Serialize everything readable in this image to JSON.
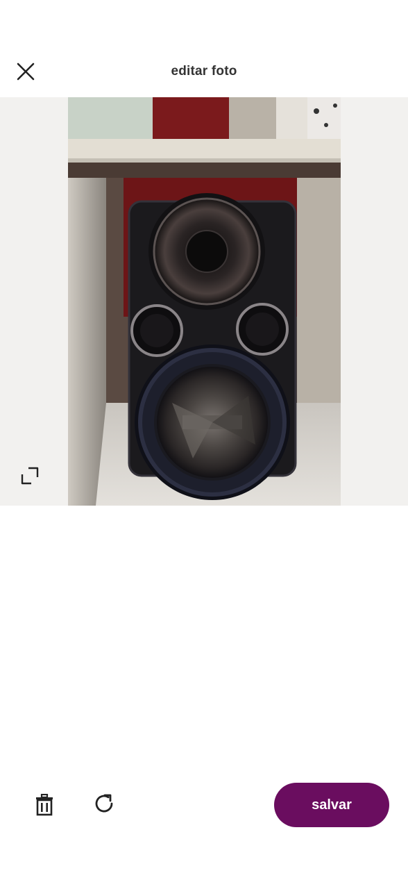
{
  "header": {
    "title": "editar foto",
    "close_icon": "close-icon"
  },
  "preview": {
    "resize_icon": "resize-icon",
    "photo_description_icon": "speaker-photo"
  },
  "footer": {
    "delete_icon": "trash-icon",
    "rotate_icon": "rotate-icon",
    "save_label": "salvar"
  },
  "colors": {
    "accent": "#6a0d5f",
    "preview_background": "#f2f1ef",
    "icon": "#222222"
  }
}
